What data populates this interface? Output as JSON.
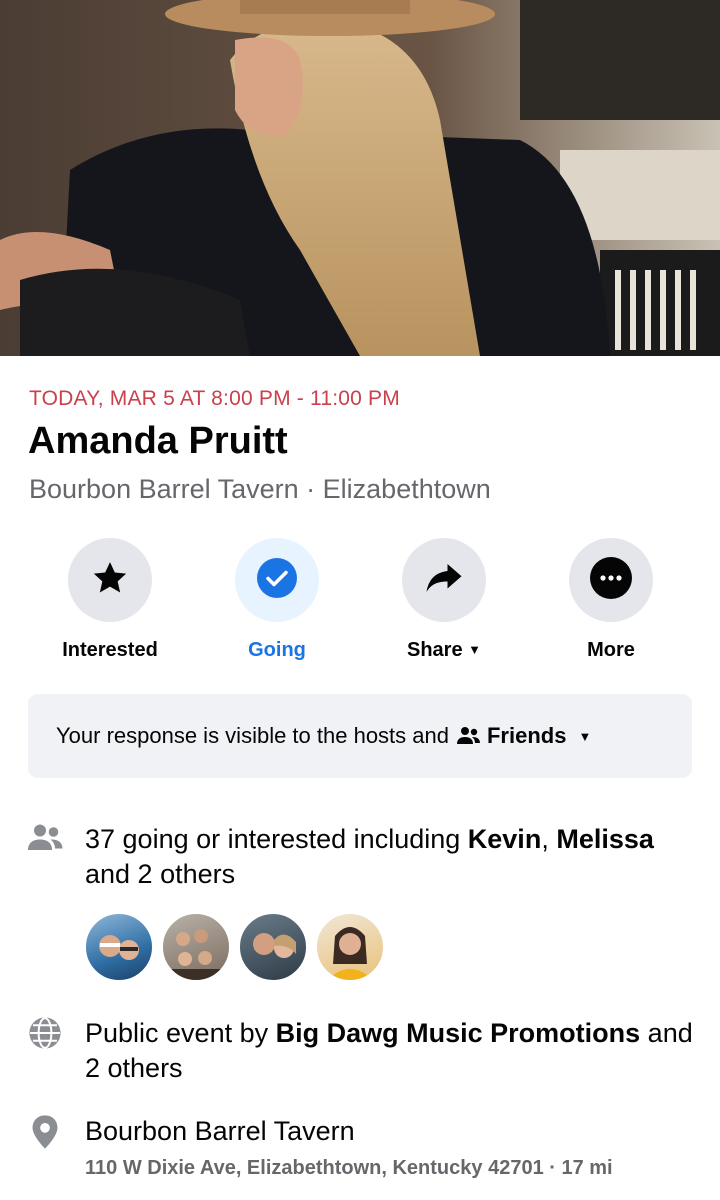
{
  "event": {
    "when": "TODAY, MAR 5 AT 8:00 PM - 11:00 PM",
    "title": "Amanda Pruitt",
    "venue_line": "Bourbon Barrel Tavern · Elizabethtown"
  },
  "actions": [
    {
      "label": "Interested",
      "icon": "star-icon"
    },
    {
      "label": "Going",
      "icon": "check-circle-icon"
    },
    {
      "label": "Share",
      "icon": "share-arrow-icon"
    },
    {
      "label": "More",
      "icon": "more-dots-icon"
    }
  ],
  "visibility": {
    "prefix": "Your response is visible to the hosts and",
    "audience": "Friends"
  },
  "attendance": {
    "prefix": "37 going or interested including",
    "name1": "Kevin",
    "sep": ",",
    "name2": "Melissa",
    "suffix": "and 2 others"
  },
  "host": {
    "prefix": "Public event by",
    "name": "Big Dawg Music Promotions",
    "suffix": "and 2 others"
  },
  "location": {
    "name": "Bourbon Barrel Tavern",
    "address": "110 W Dixie Ave, Elizabethtown, Kentucky 42701 · 17 mi"
  },
  "colors": {
    "date_red": "#c8414d",
    "accent_blue": "#1b74e4",
    "secondary_text": "#65676b"
  }
}
